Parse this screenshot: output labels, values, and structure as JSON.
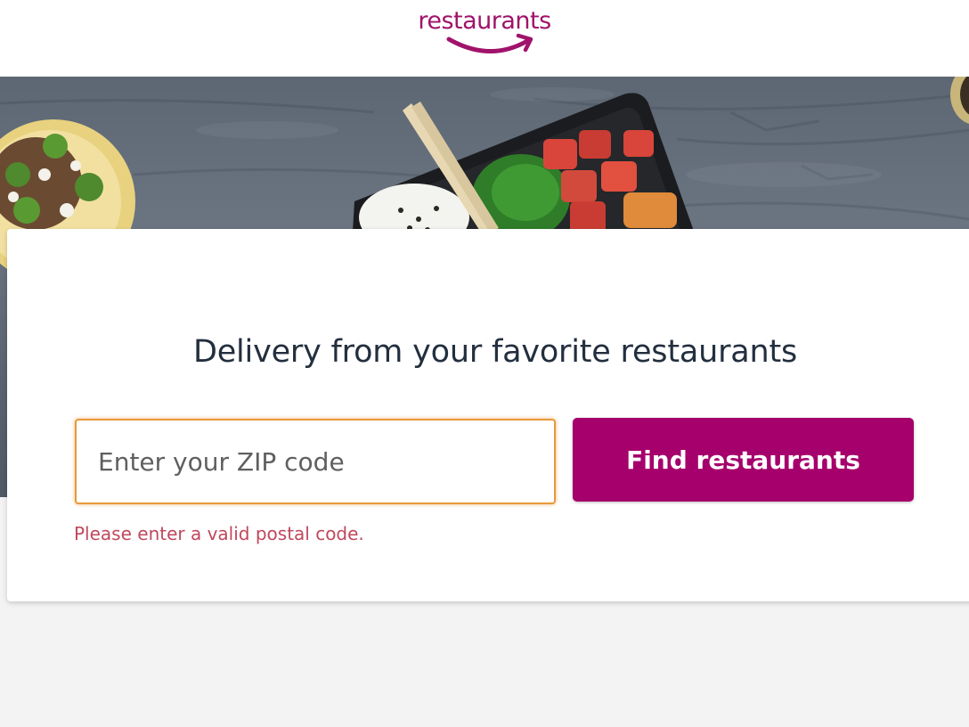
{
  "header": {
    "logo_text": "restaurants",
    "logo_icon": "smile-arrow-icon"
  },
  "hero": {
    "image": "food-photo-banner"
  },
  "card": {
    "headline": "Delivery from your favorite restaurants",
    "zip_input": {
      "placeholder": "Enter your ZIP code",
      "value": ""
    },
    "find_button_label": "Find restaurants",
    "error_message": "Please enter a valid postal code."
  },
  "colors": {
    "brand": "#a5006b",
    "focus_border": "#e79a3a",
    "error": "#c0485d",
    "headline": "#232f3e"
  }
}
